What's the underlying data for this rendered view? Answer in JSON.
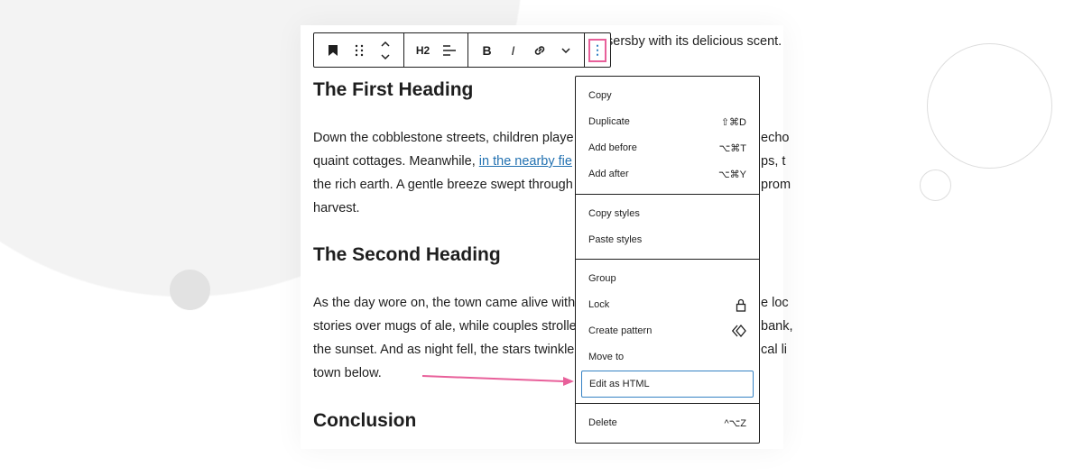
{
  "toolbar": {
    "items": [
      "bookmark-icon",
      "drag-handle-icon",
      "move-up-down-icon"
    ],
    "heading_level": "H2",
    "bold": "B",
    "italic": "I",
    "options": "⋮"
  },
  "content": {
    "top_fragment": "sersby with its delicious scent.",
    "heading1": "The First Heading",
    "para1": {
      "lines": [
        "Down the cobblestone streets, children playe",
        "quaint cottages. Meanwhile, ",
        "the rich earth. A gentle breeze swept through",
        "harvest."
      ],
      "link": "in the nearby fie",
      "right": [
        "echo",
        "ps, t",
        "prom"
      ]
    },
    "heading2": "The Second Heading",
    "para2": {
      "lines": [
        "As the day wore on, the town came alive with",
        "stories over mugs of ale, while couples strolle",
        "the sunset. And as night fell, the stars twinkle",
        "town below."
      ],
      "right": [
        "e loc",
        "bank,",
        "cal li"
      ]
    },
    "heading3": "Conclusion"
  },
  "menu": {
    "items": [
      {
        "label": "Copy",
        "shortcut": ""
      },
      {
        "label": "Duplicate",
        "shortcut": "⇧⌘D"
      },
      {
        "label": "Add before",
        "shortcut": "⌥⌘T"
      },
      {
        "label": "Add after",
        "shortcut": "⌥⌘Y"
      },
      {
        "label": "Copy styles",
        "shortcut": ""
      },
      {
        "label": "Paste styles",
        "shortcut": ""
      },
      {
        "label": "Group",
        "shortcut": ""
      },
      {
        "label": "Lock",
        "shortcut": "🔒"
      },
      {
        "label": "Create pattern",
        "shortcut": "◇"
      },
      {
        "label": "Move to",
        "shortcut": ""
      },
      {
        "label": "Edit as HTML",
        "shortcut": ""
      },
      {
        "label": "Delete",
        "shortcut": "^⌥Z"
      }
    ]
  },
  "colors": {
    "highlight": "#e8609a",
    "focus": "#3582c4",
    "link": "#2271b1"
  }
}
